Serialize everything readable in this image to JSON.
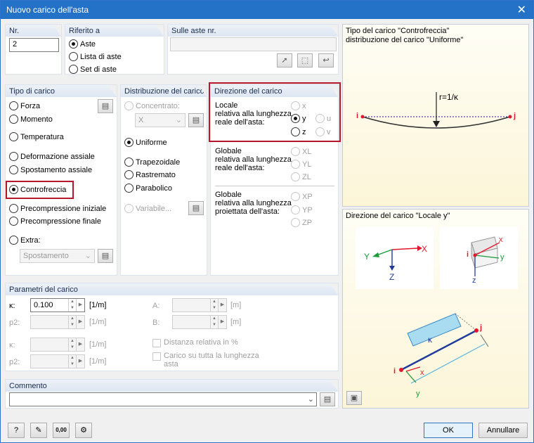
{
  "window": {
    "title": "Nuovo carico dell'asta"
  },
  "nr": {
    "label": "Nr.",
    "value": "2"
  },
  "riferimento": {
    "label": "Riferito a",
    "options": [
      "Aste",
      "Lista di aste",
      "Set di aste"
    ]
  },
  "sulle_aste": {
    "label": "Sulle aste nr."
  },
  "tipo": {
    "label": "Tipo di carico",
    "options": [
      "Forza",
      "Momento",
      "Temperatura",
      "Deformazione assiale",
      "Spostamento assiale",
      "Controfreccia",
      "Precompressione iniziale",
      "Precompressione finale",
      "Extra:"
    ],
    "extra_select": "Spostamento"
  },
  "distribuzione": {
    "label": "Distribuzione del carico",
    "concentrato": "Concentrato:",
    "concentrato_select": "X",
    "options": [
      "Uniforme",
      "Trapezoidale",
      "Rastremato",
      "Parabolico"
    ],
    "variabile": "Variabile..."
  },
  "direzione": {
    "label": "Direzione del carico",
    "locale": "Locale\nrelativa alla lunghezza\nreale dell'asta:",
    "globale1": "Globale\nrelativa alla lunghezza\nreale dell'asta:",
    "globale2": "Globale\nrelativa alla lunghezza\nproiettata dell'asta:",
    "loc_opts": [
      "x",
      "y",
      "z",
      "u",
      "v"
    ],
    "g1_opts": [
      "XL",
      "YL",
      "ZL"
    ],
    "g2_opts": [
      "XP",
      "YP",
      "ZP"
    ]
  },
  "parametri": {
    "label": "Parametri del carico",
    "k": "κ:",
    "p2": "p2:",
    "k_value": "0.100",
    "unit": "[1/m]",
    "A": "A:",
    "B": "B:",
    "m": "[m]",
    "k2": "κ:",
    "p2b": "p2:",
    "dist_rel": "Distanza relativa in %",
    "carico_tutta": "Carico su tutta la lunghezza\nasta"
  },
  "commento": {
    "label": "Commento"
  },
  "preview1": {
    "title": "Tipo del carico \"Controfreccia\"\ndistribuzione del carico \"Uniforme\"",
    "r_label": "r=1/κ",
    "i": "i",
    "j": "j"
  },
  "preview2": {
    "title": "Direzione del carico \"Locale y\"",
    "X": "X",
    "Y": "Y",
    "Z": "Z",
    "x": "x",
    "y": "y",
    "z": "z",
    "i": "i",
    "j": "j",
    "kappa": "κ"
  },
  "buttons": {
    "ok": "OK",
    "cancel": "Annullare",
    "units": "0,00"
  },
  "colors": {
    "accent": "#2472c8",
    "highlight": "#b5172b",
    "axis_red": "#e0182b",
    "axis_green": "#1b9a3a",
    "axis_blue": "#1f3c9c"
  }
}
